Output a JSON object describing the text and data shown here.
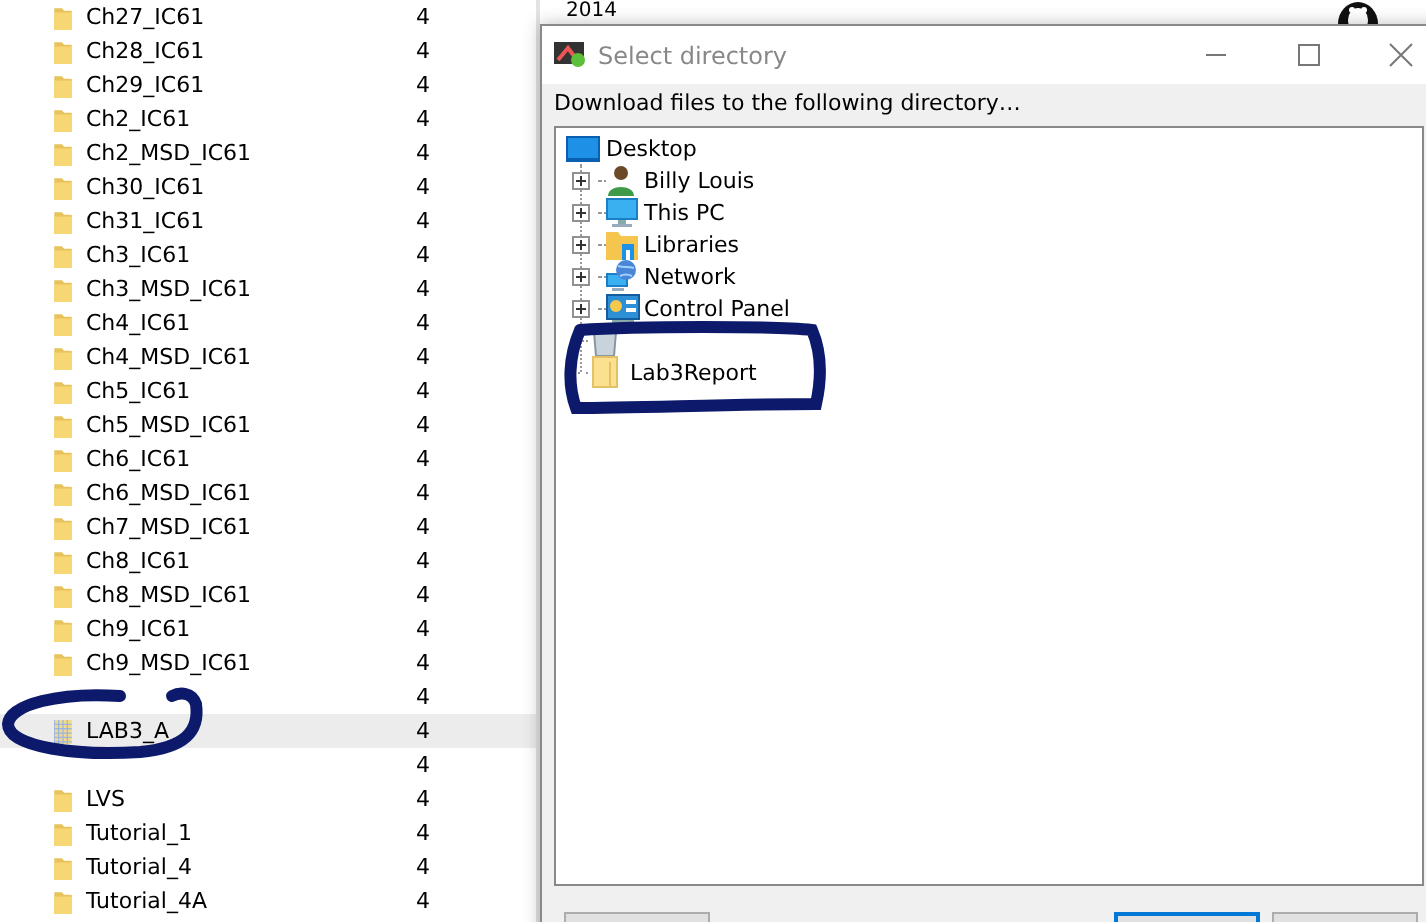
{
  "header": {
    "year": "2014"
  },
  "file_list": {
    "rows": [
      {
        "name": "Ch27_IC61",
        "count": "4",
        "kind": "folder",
        "selected": false
      },
      {
        "name": "Ch28_IC61",
        "count": "4",
        "kind": "folder",
        "selected": false
      },
      {
        "name": "Ch29_IC61",
        "count": "4",
        "kind": "folder",
        "selected": false
      },
      {
        "name": "Ch2_IC61",
        "count": "4",
        "kind": "folder",
        "selected": false
      },
      {
        "name": "Ch2_MSD_IC61",
        "count": "4",
        "kind": "folder",
        "selected": false
      },
      {
        "name": "Ch30_IC61",
        "count": "4",
        "kind": "folder",
        "selected": false
      },
      {
        "name": "Ch31_IC61",
        "count": "4",
        "kind": "folder",
        "selected": false
      },
      {
        "name": "Ch3_IC61",
        "count": "4",
        "kind": "folder",
        "selected": false
      },
      {
        "name": "Ch3_MSD_IC61",
        "count": "4",
        "kind": "folder",
        "selected": false
      },
      {
        "name": "Ch4_IC61",
        "count": "4",
        "kind": "folder",
        "selected": false
      },
      {
        "name": "Ch4_MSD_IC61",
        "count": "4",
        "kind": "folder",
        "selected": false
      },
      {
        "name": "Ch5_IC61",
        "count": "4",
        "kind": "folder",
        "selected": false
      },
      {
        "name": "Ch5_MSD_IC61",
        "count": "4",
        "kind": "folder",
        "selected": false
      },
      {
        "name": "Ch6_IC61",
        "count": "4",
        "kind": "folder",
        "selected": false
      },
      {
        "name": "Ch6_MSD_IC61",
        "count": "4",
        "kind": "folder",
        "selected": false
      },
      {
        "name": "Ch7_MSD_IC61",
        "count": "4",
        "kind": "folder",
        "selected": false
      },
      {
        "name": "Ch8_IC61",
        "count": "4",
        "kind": "folder",
        "selected": false
      },
      {
        "name": "Ch8_MSD_IC61",
        "count": "4",
        "kind": "folder",
        "selected": false
      },
      {
        "name": "Ch9_IC61",
        "count": "4",
        "kind": "folder",
        "selected": false
      },
      {
        "name": "Ch9_MSD_IC61",
        "count": "4",
        "kind": "folder",
        "selected": false
      },
      {
        "count": "4",
        "kind": "covered",
        "selected": false
      },
      {
        "name": "LAB3_A",
        "count": "4",
        "kind": "library",
        "selected": true
      },
      {
        "count": "4",
        "kind": "covered",
        "selected": false
      },
      {
        "name": "LVS",
        "count": "4",
        "kind": "folder",
        "selected": false
      },
      {
        "name": "Tutorial_1",
        "count": "4",
        "kind": "folder",
        "selected": false
      },
      {
        "name": "Tutorial_4",
        "count": "4",
        "kind": "folder",
        "selected": false
      },
      {
        "name": "Tutorial_4A",
        "count": "4",
        "kind": "folder",
        "selected": false
      }
    ]
  },
  "dialog": {
    "title": "Select directory",
    "prompt": "Download files to the following directory…",
    "tree": {
      "label": "Desktop",
      "kind": "desktop",
      "children": [
        {
          "label": "Billy Louis",
          "kind": "user",
          "expandable": true
        },
        {
          "label": "This PC",
          "kind": "pc",
          "expandable": true
        },
        {
          "label": "Libraries",
          "kind": "libraries",
          "expandable": true
        },
        {
          "label": "Network",
          "kind": "network",
          "expandable": true
        },
        {
          "label": "Control Panel",
          "kind": "control-panel",
          "expandable": true
        },
        {
          "kind": "recycle-bin",
          "expandable": false
        },
        {
          "label": "Lab3Report",
          "kind": "folder",
          "expandable": false
        }
      ]
    },
    "buttons": [
      {
        "focused": false
      },
      {
        "focused": true
      },
      {
        "focused": false
      }
    ]
  }
}
